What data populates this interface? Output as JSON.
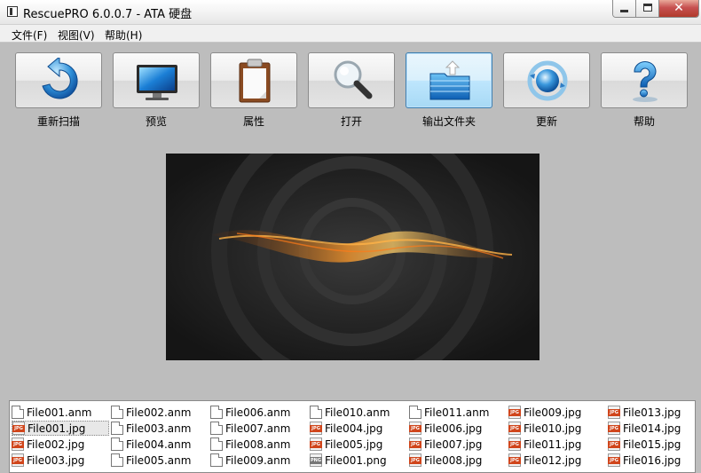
{
  "window": {
    "title": "RescuePRO 6.0.0.7 - ATA 硬盘"
  },
  "menu": [
    {
      "label": "文件(F)"
    },
    {
      "label": "视图(V)"
    },
    {
      "label": "帮助(H)"
    }
  ],
  "toolbar": [
    {
      "label": "重新扫描",
      "icon": "rescan-icon"
    },
    {
      "label": "预览",
      "icon": "monitor-icon"
    },
    {
      "label": "属性",
      "icon": "clipboard-icon"
    },
    {
      "label": "打开",
      "icon": "magnifier-icon"
    },
    {
      "label": "输出文件夹",
      "icon": "folder-icon",
      "active": true
    },
    {
      "label": "更新",
      "icon": "update-globe-icon"
    },
    {
      "label": "帮助",
      "icon": "help-icon"
    }
  ],
  "files": [
    [
      {
        "name": "File001.anm",
        "type": "anm"
      },
      {
        "name": "File001.jpg",
        "type": "jpg",
        "selected": true
      },
      {
        "name": "File002.jpg",
        "type": "jpg"
      },
      {
        "name": "File003.jpg",
        "type": "jpg"
      }
    ],
    [
      {
        "name": "File002.anm",
        "type": "anm"
      },
      {
        "name": "File003.anm",
        "type": "anm"
      },
      {
        "name": "File004.anm",
        "type": "anm"
      },
      {
        "name": "File005.anm",
        "type": "anm"
      }
    ],
    [
      {
        "name": "File006.anm",
        "type": "anm"
      },
      {
        "name": "File007.anm",
        "type": "anm"
      },
      {
        "name": "File008.anm",
        "type": "anm"
      },
      {
        "name": "File009.anm",
        "type": "anm"
      }
    ],
    [
      {
        "name": "File010.anm",
        "type": "anm"
      },
      {
        "name": "File004.jpg",
        "type": "jpg"
      },
      {
        "name": "File005.jpg",
        "type": "jpg"
      },
      {
        "name": "File001.png",
        "type": "png"
      }
    ],
    [
      {
        "name": "File011.anm",
        "type": "anm"
      },
      {
        "name": "File006.jpg",
        "type": "jpg"
      },
      {
        "name": "File007.jpg",
        "type": "jpg"
      },
      {
        "name": "File008.jpg",
        "type": "jpg"
      }
    ],
    [
      {
        "name": "File009.jpg",
        "type": "jpg"
      },
      {
        "name": "File010.jpg",
        "type": "jpg"
      },
      {
        "name": "File011.jpg",
        "type": "jpg"
      },
      {
        "name": "File012.jpg",
        "type": "jpg"
      }
    ],
    [
      {
        "name": "File013.jpg",
        "type": "jpg"
      },
      {
        "name": "File014.jpg",
        "type": "jpg"
      },
      {
        "name": "File015.jpg",
        "type": "jpg"
      },
      {
        "name": "File016.jpg",
        "type": "jpg"
      }
    ]
  ]
}
